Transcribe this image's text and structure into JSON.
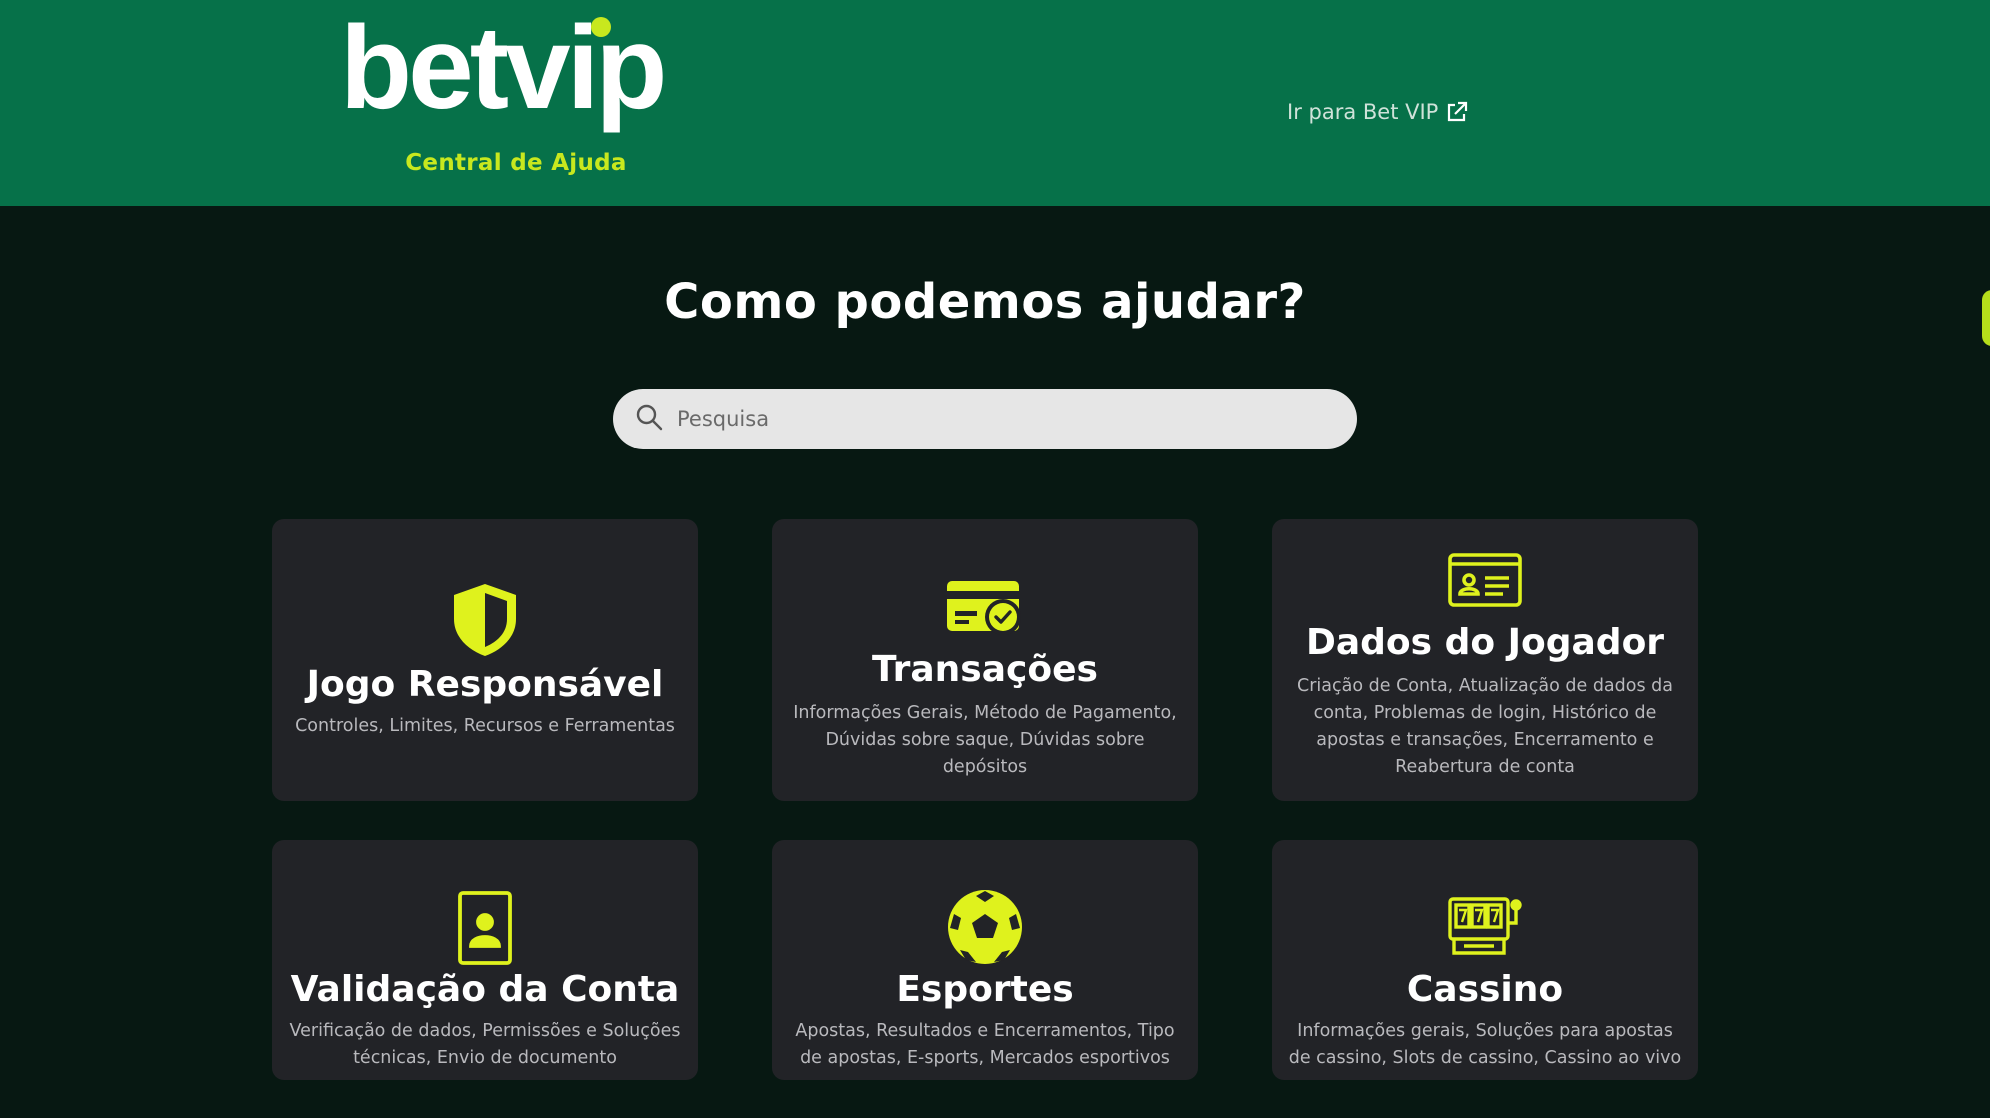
{
  "header": {
    "brand": "betvip",
    "tagline": "Central de Ajuda",
    "external_link": "Ir para Bet VIP",
    "colors": {
      "header_bg": "#067149",
      "accent": "#c8e81e",
      "page_bg": "#071812",
      "card_bg": "#222327"
    }
  },
  "hero": {
    "title": "Como podemos ajudar?",
    "search_placeholder": "Pesquisa"
  },
  "categories": [
    {
      "title": "Jogo Responsável",
      "description": "Controles, Limites, Recursos e Ferramentas",
      "icon": "shield-icon"
    },
    {
      "title": "Transações",
      "description": "Informações Gerais, Método de Pagamento, Dúvidas sobre saque, Dúvidas sobre depósitos",
      "icon": "credit-card-check-icon"
    },
    {
      "title": "Dados do Jogador",
      "description": "Criação de Conta, Atualização de dados da conta, Problemas de login, Histórico de apostas e transações, Encerramento e Reabertura de conta",
      "icon": "id-card-icon"
    },
    {
      "title": "Validação da Conta",
      "description": "Verificação de dados, Permissões e Soluções técnicas, Envio de documento",
      "icon": "badge-icon"
    },
    {
      "title": "Esportes",
      "description": "Apostas, Resultados e Encerramentos, Tipo de apostas, E-sports, Mercados esportivos",
      "icon": "soccer-ball-icon"
    },
    {
      "title": "Cassino",
      "description": "Informações gerais, Soluções para apostas de cassino, Slots de cassino, Cassino ao vivo",
      "icon": "slot-machine-icon"
    }
  ]
}
